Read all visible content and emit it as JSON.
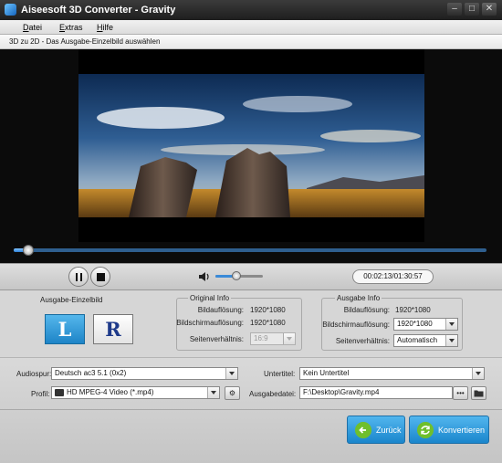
{
  "window": {
    "title": "Aiseesoft 3D Converter - Gravity",
    "icon": "app-logo-icon",
    "controls": [
      "minimize-icon",
      "maximize-icon",
      "close-icon"
    ]
  },
  "menu": {
    "items": [
      "Datei",
      "Extras",
      "Hilfe"
    ]
  },
  "step": {
    "text": "3D zu 2D - Das Ausgabe-Einzelbild auswählen"
  },
  "player": {
    "progress_fraction": 0.03,
    "volume_fraction": 0.45,
    "time": "00:02:13/01:30:57"
  },
  "output_frame": {
    "label": "Ausgabe-Einzelbild",
    "left": "L",
    "right": "R",
    "selected": "L"
  },
  "original_info": {
    "title": "Original Info",
    "resolution_label": "Bildauflösung:",
    "resolution": "1920*1080",
    "screen_label": "Bildschirmauflösung:",
    "screen": "1920*1080",
    "aspect_label": "Seitenverhältnis:",
    "aspect": "16:9"
  },
  "output_info": {
    "title": "Ausgabe Info",
    "resolution_label": "Bildauflösung:",
    "resolution": "1920*1080",
    "screen_label": "Bildschirmauflösung:",
    "screen": "1920*1080",
    "aspect_label": "Seitenverhältnis:",
    "aspect": "Automatisch"
  },
  "audio": {
    "label": "Audiospur:",
    "value": "Deutsch ac3 5.1 (0x2)"
  },
  "subtitle": {
    "label": "Untertitel:",
    "value": "Kein Untertitel"
  },
  "profile": {
    "label": "Profil:",
    "value": "HD MPEG-4 Video (*.mp4)"
  },
  "output_file": {
    "label": "Ausgabedatei:",
    "value": "F:\\Desktop\\Gravity.mp4",
    "browse": "•••"
  },
  "buttons": {
    "back": "Zurück",
    "convert": "Konvertieren"
  }
}
